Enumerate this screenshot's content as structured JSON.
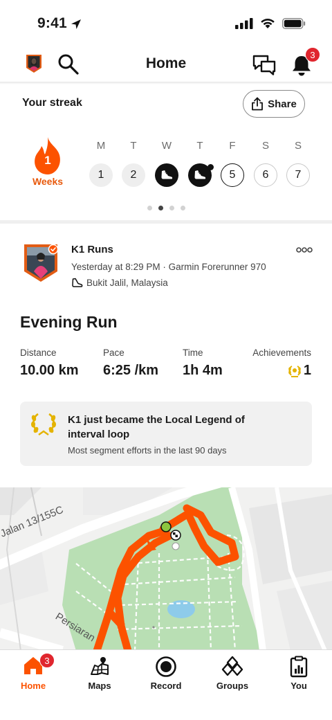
{
  "status_bar": {
    "time": "9:41"
  },
  "nav": {
    "title": "Home",
    "notification_count": "3"
  },
  "streak": {
    "title": "Your streak",
    "share_label": "Share",
    "count": "1",
    "unit": "Weeks",
    "days": [
      {
        "letter": "M",
        "num": "1",
        "state": "upcoming-grey"
      },
      {
        "letter": "T",
        "num": "2",
        "state": "upcoming-grey"
      },
      {
        "letter": "W",
        "num": "",
        "state": "completed"
      },
      {
        "letter": "T",
        "num": "",
        "state": "completed-today"
      },
      {
        "letter": "F",
        "num": "5",
        "state": "outlined"
      },
      {
        "letter": "S",
        "num": "6",
        "state": "future"
      },
      {
        "letter": "S",
        "num": "7",
        "state": "future"
      }
    ],
    "page_count": 4,
    "active_page": 1
  },
  "activity": {
    "athlete": "K1 Runs",
    "meta": "Yesterday at 8:29 PM · Garmin Forerunner 970",
    "location": "Bukit Jalil, Malaysia",
    "title": "Evening Run",
    "stats": [
      {
        "label": "Distance",
        "value": "10.00 km"
      },
      {
        "label": "Pace",
        "value": "6:25 /km"
      },
      {
        "label": "Time",
        "value": "1h 4m"
      }
    ],
    "achievements_label": "Achievements",
    "achievements_value": "1",
    "legend": {
      "title": "K1 just became the Local Legend of interval loop",
      "subtitle": "Most segment efforts in the last 90 days"
    }
  },
  "map": {
    "street_1": "Jalan 13/155C",
    "street_2": "Persiaran",
    "route_color": "#fc5200",
    "park_color": "#b9dfb4"
  },
  "tabs": [
    {
      "label": "Home",
      "icon": "home-icon",
      "badge": "3",
      "active": true
    },
    {
      "label": "Maps",
      "icon": "maps-icon"
    },
    {
      "label": "Record",
      "icon": "record-icon"
    },
    {
      "label": "Groups",
      "icon": "groups-icon"
    },
    {
      "label": "You",
      "icon": "you-icon"
    }
  ],
  "colors": {
    "accent": "#fc5200",
    "badge": "#e0262e",
    "gold": "#e4b300"
  }
}
